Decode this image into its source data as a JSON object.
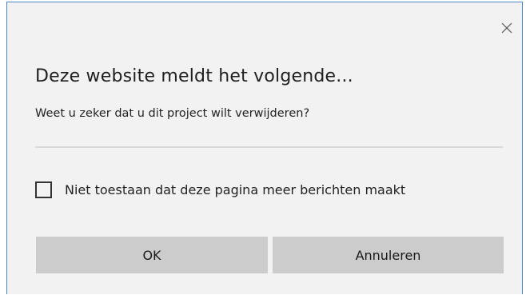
{
  "dialog": {
    "close_icon": "close-icon",
    "title": "Deze website meldt het volgende...",
    "message": "Weet u zeker dat u dit project wilt verwijderen?",
    "checkbox": {
      "label": "Niet toestaan dat deze pagina meer berichten maakt",
      "checked": false
    },
    "buttons": {
      "ok_label": "OK",
      "cancel_label": "Annuleren"
    }
  },
  "colors": {
    "border": "#4f86c6",
    "background": "#f2f2f2",
    "button": "#cccccc",
    "divider": "#d9d9d9"
  }
}
